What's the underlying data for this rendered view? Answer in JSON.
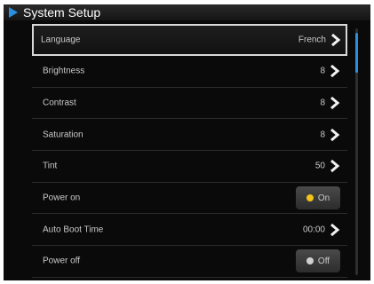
{
  "window": {
    "title": "System Setup"
  },
  "colors": {
    "accent": "#2a8fe0",
    "on_indicator": "#f2c318",
    "background": "#0a0a0a",
    "text": "#c9c9c9"
  },
  "settings": [
    {
      "label": "Language",
      "value": "French",
      "kind": "arrow",
      "selected": true
    },
    {
      "label": "Brightness",
      "value": "8",
      "kind": "arrow"
    },
    {
      "label": "Contrast",
      "value": "8",
      "kind": "arrow"
    },
    {
      "label": "Saturation",
      "value": "8",
      "kind": "arrow"
    },
    {
      "label": "Tint",
      "value": "50",
      "kind": "arrow"
    },
    {
      "label": "Power on",
      "value": "On",
      "kind": "toggle",
      "state": true
    },
    {
      "label": "Auto Boot Time",
      "value": "00:00",
      "kind": "arrow"
    },
    {
      "label": "Power off",
      "value": "Off",
      "kind": "toggle",
      "state": false
    }
  ],
  "icons": {
    "title": "play-arrow-icon",
    "arrow": "chevron-right-icon"
  }
}
